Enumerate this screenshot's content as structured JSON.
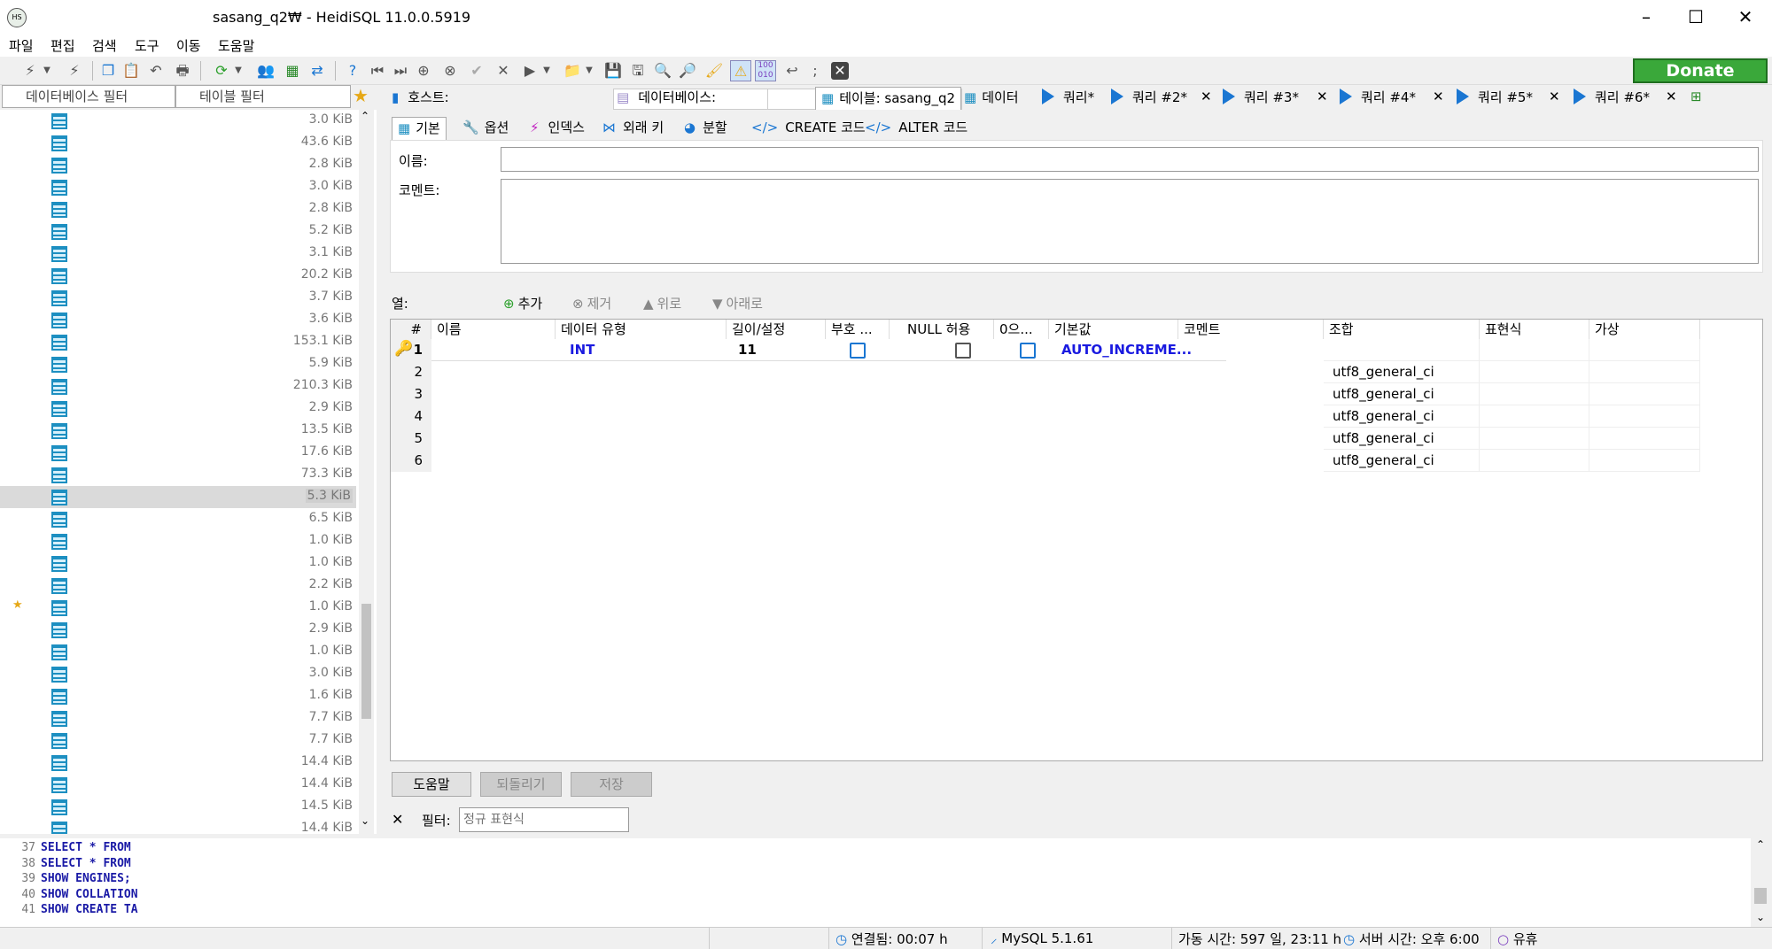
{
  "window": {
    "title": "sasang_q2₩ - HeidiSQL 11.0.0.5919",
    "logo_text": "HS"
  },
  "menu": [
    "파일",
    "편집",
    "검색",
    "도구",
    "이동",
    "도움말"
  ],
  "donate_label": "Donate",
  "filters": {
    "database": "데이터베이스 필터",
    "table": "테이블 필터"
  },
  "tree_sizes": [
    "3.0 KiB",
    "43.6 KiB",
    "2.8 KiB",
    "3.0 KiB",
    "2.8 KiB",
    "5.2 KiB",
    "3.1 KiB",
    "20.2 KiB",
    "3.7 KiB",
    "3.6 KiB",
    "153.1 KiB",
    "5.9 KiB",
    "210.3 KiB",
    "2.9 KiB",
    "13.5 KiB",
    "17.6 KiB",
    "73.3 KiB",
    "5.3 KiB",
    "6.5 KiB",
    "1.0 KiB",
    "1.0 KiB",
    "2.2 KiB",
    "1.0 KiB",
    "2.9 KiB",
    "1.0 KiB",
    "3.0 KiB",
    "1.6 KiB",
    "7.7 KiB",
    "7.7 KiB",
    "14.4 KiB",
    "14.4 KiB",
    "14.5 KiB",
    "14.4 KiB"
  ],
  "tree_selected_index": 17,
  "tree_starred_index": 22,
  "tabs": {
    "host": "호스트:",
    "database": "데이터베이스:",
    "table": "테이블: sasang_q2",
    "data": "데이터",
    "queries": [
      "쿼리*",
      "쿼리 #2*",
      "쿼리 #3*",
      "쿼리 #4*",
      "쿼리 #5*",
      "쿼리 #6*"
    ]
  },
  "subtabs": [
    "기본",
    "옵션",
    "인덱스",
    "외래 키",
    "분할",
    "CREATE 코드",
    "ALTER 코드"
  ],
  "form": {
    "name_label": "이름:",
    "comment_label": "코멘트:",
    "name_value": "",
    "comment_value": ""
  },
  "columns_toolbar": {
    "label": "열:",
    "add": "추가",
    "remove": "제거",
    "up": "위로",
    "down": "아래로"
  },
  "grid": {
    "headers": [
      "#",
      "이름",
      "데이터 유형",
      "길이/설정",
      "부호 ...",
      "NULL 허용",
      "0으...",
      "기본값",
      "코멘트",
      "조합",
      "표현식",
      "가상"
    ],
    "rows": [
      {
        "num": "1",
        "name": "",
        "type": "INT",
        "length": "11",
        "default": "AUTO_INCREME...",
        "collation": ""
      },
      {
        "num": "2",
        "name": "",
        "type": "",
        "length": "",
        "default": "",
        "collation": "utf8_general_ci"
      },
      {
        "num": "3",
        "name": "",
        "type": "",
        "length": "",
        "default": "",
        "collation": "utf8_general_ci"
      },
      {
        "num": "4",
        "name": "",
        "type": "",
        "length": "",
        "default": "",
        "collation": "utf8_general_ci"
      },
      {
        "num": "5",
        "name": "",
        "type": "",
        "length": "",
        "default": "",
        "collation": "utf8_general_ci"
      },
      {
        "num": "6",
        "name": "",
        "type": "",
        "length": "",
        "default": "",
        "collation": "utf8_general_ci"
      }
    ]
  },
  "buttons": {
    "help": "도움말",
    "revert": "되돌리기",
    "save": "저장"
  },
  "filter": {
    "label": "필터:",
    "placeholder": "정규 표현식"
  },
  "sqllog": [
    {
      "n": "37",
      "t": "SELECT * FROM"
    },
    {
      "n": "38",
      "t": "SELECT * FROM"
    },
    {
      "n": "39",
      "t": "SHOW ENGINES;"
    },
    {
      "n": "40",
      "t": "SHOW COLLATION"
    },
    {
      "n": "41",
      "t": "SHOW CREATE TA"
    }
  ],
  "status": {
    "connected": "연결됨: 00:07 h",
    "server": "MySQL 5.1.61",
    "uptime": "가동 시간: 597 일, 23:11 h",
    "server_time": "서버 시간: 오후 6:00",
    "idle": "유휴"
  }
}
